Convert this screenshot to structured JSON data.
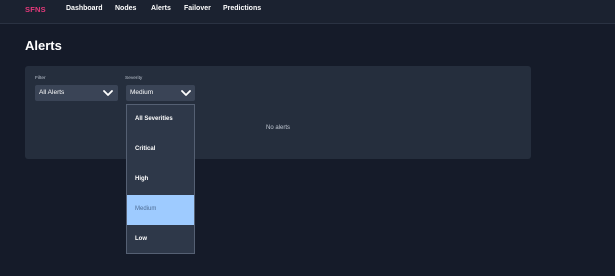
{
  "brand": "SFNS",
  "nav": [
    "Dashboard",
    "Nodes",
    "Alerts",
    "Failover",
    "Predictions"
  ],
  "page": {
    "title": "Alerts"
  },
  "filters": {
    "filter": {
      "label": "Filter",
      "value": "All Alerts"
    },
    "severity": {
      "label": "Severity",
      "value": "Medium"
    }
  },
  "empty_text": "No alerts",
  "severity_options": [
    "All Severities",
    "Critical",
    "High",
    "Medium",
    "Low"
  ],
  "selected_option": "Medium",
  "colors": {
    "brand": "#e5397b",
    "selected": "#9ecbff",
    "background": "#151b29",
    "card": "#252e3d"
  }
}
